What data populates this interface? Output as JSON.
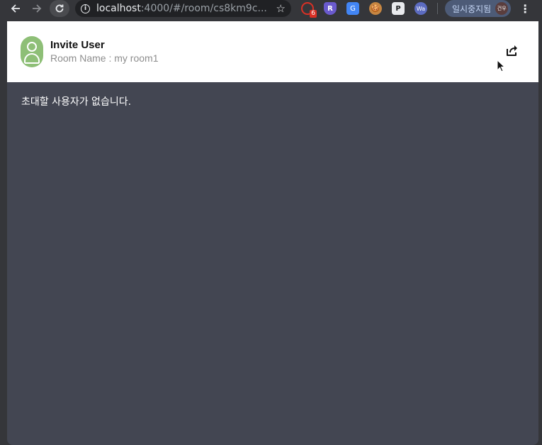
{
  "browser": {
    "url_host": "localhost",
    "url_path": ":4000/#/room/cs8km9c...",
    "extensions": [
      {
        "name": "extension-1",
        "badge": "6"
      },
      {
        "name": "extension-2",
        "label": "R"
      },
      {
        "name": "extension-3",
        "label": "G"
      },
      {
        "name": "extension-4",
        "label": "🍪"
      },
      {
        "name": "extension-5",
        "label": "P"
      },
      {
        "name": "extension-6",
        "label": "Wa"
      }
    ],
    "profile_status": "일시중지됨",
    "profile_avatar_text": "건우"
  },
  "header": {
    "title": "Invite User",
    "subtitle": "Room Name : my room1"
  },
  "content": {
    "empty_message": "초대할 사용자가 없습니다."
  },
  "colors": {
    "page_background": "#434652",
    "header_background": "#ffffff",
    "avatar_green": "#8ebf77"
  }
}
